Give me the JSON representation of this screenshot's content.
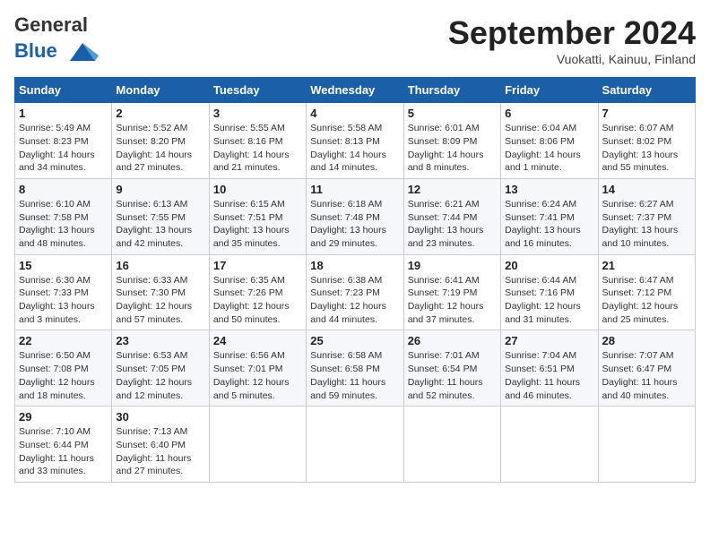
{
  "header": {
    "logo_line1": "General",
    "logo_line2": "Blue",
    "month": "September 2024",
    "location": "Vuokatti, Kainuu, Finland"
  },
  "weekdays": [
    "Sunday",
    "Monday",
    "Tuesday",
    "Wednesday",
    "Thursday",
    "Friday",
    "Saturday"
  ],
  "weeks": [
    [
      {
        "day": "1",
        "sunrise": "Sunrise: 5:49 AM",
        "sunset": "Sunset: 8:23 PM",
        "daylight": "Daylight: 14 hours and 34 minutes."
      },
      {
        "day": "2",
        "sunrise": "Sunrise: 5:52 AM",
        "sunset": "Sunset: 8:20 PM",
        "daylight": "Daylight: 14 hours and 27 minutes."
      },
      {
        "day": "3",
        "sunrise": "Sunrise: 5:55 AM",
        "sunset": "Sunset: 8:16 PM",
        "daylight": "Daylight: 14 hours and 21 minutes."
      },
      {
        "day": "4",
        "sunrise": "Sunrise: 5:58 AM",
        "sunset": "Sunset: 8:13 PM",
        "daylight": "Daylight: 14 hours and 14 minutes."
      },
      {
        "day": "5",
        "sunrise": "Sunrise: 6:01 AM",
        "sunset": "Sunset: 8:09 PM",
        "daylight": "Daylight: 14 hours and 8 minutes."
      },
      {
        "day": "6",
        "sunrise": "Sunrise: 6:04 AM",
        "sunset": "Sunset: 8:06 PM",
        "daylight": "Daylight: 14 hours and 1 minute."
      },
      {
        "day": "7",
        "sunrise": "Sunrise: 6:07 AM",
        "sunset": "Sunset: 8:02 PM",
        "daylight": "Daylight: 13 hours and 55 minutes."
      }
    ],
    [
      {
        "day": "8",
        "sunrise": "Sunrise: 6:10 AM",
        "sunset": "Sunset: 7:58 PM",
        "daylight": "Daylight: 13 hours and 48 minutes."
      },
      {
        "day": "9",
        "sunrise": "Sunrise: 6:13 AM",
        "sunset": "Sunset: 7:55 PM",
        "daylight": "Daylight: 13 hours and 42 minutes."
      },
      {
        "day": "10",
        "sunrise": "Sunrise: 6:15 AM",
        "sunset": "Sunset: 7:51 PM",
        "daylight": "Daylight: 13 hours and 35 minutes."
      },
      {
        "day": "11",
        "sunrise": "Sunrise: 6:18 AM",
        "sunset": "Sunset: 7:48 PM",
        "daylight": "Daylight: 13 hours and 29 minutes."
      },
      {
        "day": "12",
        "sunrise": "Sunrise: 6:21 AM",
        "sunset": "Sunset: 7:44 PM",
        "daylight": "Daylight: 13 hours and 23 minutes."
      },
      {
        "day": "13",
        "sunrise": "Sunrise: 6:24 AM",
        "sunset": "Sunset: 7:41 PM",
        "daylight": "Daylight: 13 hours and 16 minutes."
      },
      {
        "day": "14",
        "sunrise": "Sunrise: 6:27 AM",
        "sunset": "Sunset: 7:37 PM",
        "daylight": "Daylight: 13 hours and 10 minutes."
      }
    ],
    [
      {
        "day": "15",
        "sunrise": "Sunrise: 6:30 AM",
        "sunset": "Sunset: 7:33 PM",
        "daylight": "Daylight: 13 hours and 3 minutes."
      },
      {
        "day": "16",
        "sunrise": "Sunrise: 6:33 AM",
        "sunset": "Sunset: 7:30 PM",
        "daylight": "Daylight: 12 hours and 57 minutes."
      },
      {
        "day": "17",
        "sunrise": "Sunrise: 6:35 AM",
        "sunset": "Sunset: 7:26 PM",
        "daylight": "Daylight: 12 hours and 50 minutes."
      },
      {
        "day": "18",
        "sunrise": "Sunrise: 6:38 AM",
        "sunset": "Sunset: 7:23 PM",
        "daylight": "Daylight: 12 hours and 44 minutes."
      },
      {
        "day": "19",
        "sunrise": "Sunrise: 6:41 AM",
        "sunset": "Sunset: 7:19 PM",
        "daylight": "Daylight: 12 hours and 37 minutes."
      },
      {
        "day": "20",
        "sunrise": "Sunrise: 6:44 AM",
        "sunset": "Sunset: 7:16 PM",
        "daylight": "Daylight: 12 hours and 31 minutes."
      },
      {
        "day": "21",
        "sunrise": "Sunrise: 6:47 AM",
        "sunset": "Sunset: 7:12 PM",
        "daylight": "Daylight: 12 hours and 25 minutes."
      }
    ],
    [
      {
        "day": "22",
        "sunrise": "Sunrise: 6:50 AM",
        "sunset": "Sunset: 7:08 PM",
        "daylight": "Daylight: 12 hours and 18 minutes."
      },
      {
        "day": "23",
        "sunrise": "Sunrise: 6:53 AM",
        "sunset": "Sunset: 7:05 PM",
        "daylight": "Daylight: 12 hours and 12 minutes."
      },
      {
        "day": "24",
        "sunrise": "Sunrise: 6:56 AM",
        "sunset": "Sunset: 7:01 PM",
        "daylight": "Daylight: 12 hours and 5 minutes."
      },
      {
        "day": "25",
        "sunrise": "Sunrise: 6:58 AM",
        "sunset": "Sunset: 6:58 PM",
        "daylight": "Daylight: 11 hours and 59 minutes."
      },
      {
        "day": "26",
        "sunrise": "Sunrise: 7:01 AM",
        "sunset": "Sunset: 6:54 PM",
        "daylight": "Daylight: 11 hours and 52 minutes."
      },
      {
        "day": "27",
        "sunrise": "Sunrise: 7:04 AM",
        "sunset": "Sunset: 6:51 PM",
        "daylight": "Daylight: 11 hours and 46 minutes."
      },
      {
        "day": "28",
        "sunrise": "Sunrise: 7:07 AM",
        "sunset": "Sunset: 6:47 PM",
        "daylight": "Daylight: 11 hours and 40 minutes."
      }
    ],
    [
      {
        "day": "29",
        "sunrise": "Sunrise: 7:10 AM",
        "sunset": "Sunset: 6:44 PM",
        "daylight": "Daylight: 11 hours and 33 minutes."
      },
      {
        "day": "30",
        "sunrise": "Sunrise: 7:13 AM",
        "sunset": "Sunset: 6:40 PM",
        "daylight": "Daylight: 11 hours and 27 minutes."
      },
      null,
      null,
      null,
      null,
      null
    ]
  ]
}
